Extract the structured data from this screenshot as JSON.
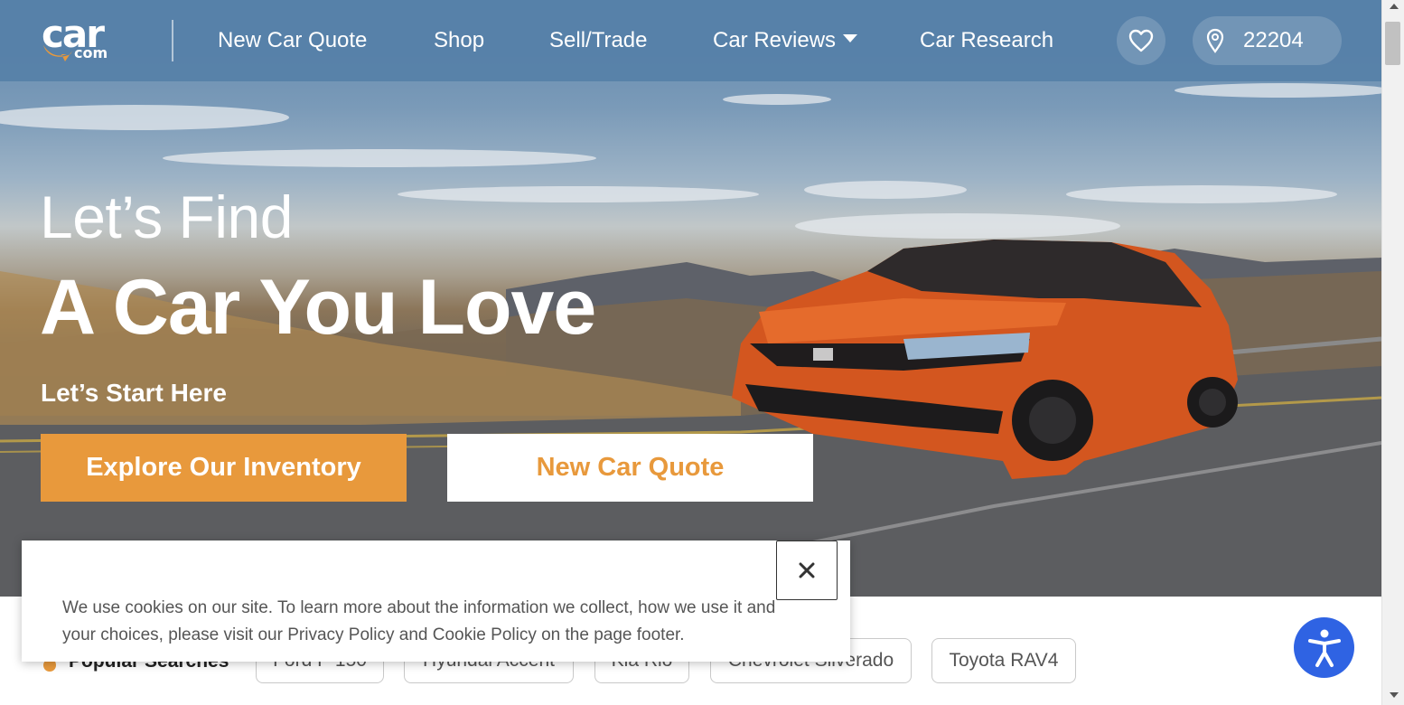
{
  "brand": {
    "logo_main": "car",
    "logo_sub": "com"
  },
  "nav": {
    "items": [
      {
        "label": "New Car Quote"
      },
      {
        "label": "Shop"
      },
      {
        "label": "Sell/Trade"
      },
      {
        "label": "Car Reviews",
        "has_dropdown": true
      },
      {
        "label": "Car Research"
      }
    ],
    "favorites_icon": "heart-icon",
    "location_icon": "map-pin-icon",
    "zip": "22204"
  },
  "hero": {
    "line1": "Let’s Find",
    "line2": "A Car You Love",
    "sub": "Let’s Start Here",
    "primary_cta": "Explore Our Inventory",
    "secondary_cta": "New Car Quote"
  },
  "popular": {
    "label": "Popular Searches",
    "icon": "flame-icon",
    "items": [
      "Ford F-150",
      "Hyundai Accent",
      "Kia Rio",
      "Chevrolet Silverado",
      "Toyota RAV4"
    ]
  },
  "cookie": {
    "text": "We use cookies on our site. To learn more about the information we collect, how we use it and your choices, please visit our Privacy Policy and Cookie Policy on the page footer.",
    "close_icon": "close-icon"
  },
  "accessibility": {
    "icon": "accessibility-icon"
  },
  "colors": {
    "accent": "#e8993c",
    "header_bg": "#5680a8",
    "a11y_blue": "#2f63e3"
  }
}
